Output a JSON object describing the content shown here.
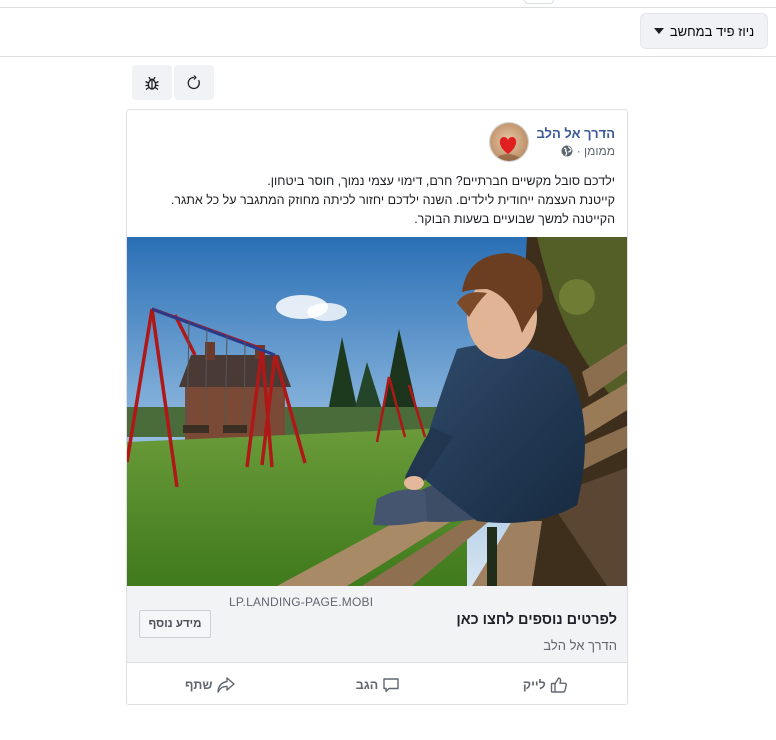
{
  "toolbar": {
    "feed_selector_label": "ניוז פיד במחשב"
  },
  "tools": {
    "debug_icon": "bug-icon",
    "refresh_icon": "refresh-icon"
  },
  "post": {
    "page_name": "הדרך אל הלב",
    "sponsored_label": "ממומן ·",
    "text_lines": [
      "ילדכם סובל מקשיים חברתיים? חרם, דימוי עצמי נמוך, חוסר ביטחון.",
      "קייטנת העצמה ייחודית לילדים. השנה ילדכם יחזור לכיתה מחוזק המתגבר על כל אתגר.",
      "הקייטנה למשך שבועיים בשעות הבוקר."
    ],
    "link": {
      "domain": "LP.LANDING-PAGE.MOBI",
      "headline": "לפרטים נוספים לחצו כאן",
      "description": "הדרך אל הלב",
      "cta_label": "מידע נוסף"
    },
    "actions": {
      "like": "לייק",
      "comment": "הגב",
      "share": "שתף"
    }
  },
  "colors": {
    "page_name": "#385898",
    "link_bg": "#f2f3f5"
  }
}
